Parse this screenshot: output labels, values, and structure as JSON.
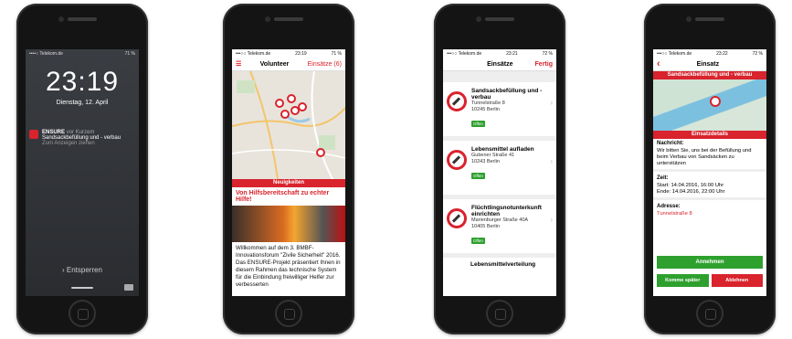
{
  "phone1": {
    "status_carrier": "••••○ Telekom.de",
    "status_battery": "71 %",
    "time": "23:19",
    "date": "Dienstag, 12. April",
    "notification_app": "ENSURE",
    "notification_time": "vor Kurzem",
    "notification_text": "Sandsackbefüllung und - verbau",
    "notification_hint": "Zum Anzeigen ziehen",
    "unlock_text": "› Entsperren"
  },
  "phone2": {
    "status_carrier": "•••○○ Telekom.de",
    "status_time": "23:19",
    "status_battery": "71 %",
    "nav_title": "Volunteer",
    "nav_right": "Einsätze (6)",
    "news_bar": "Neuigkeiten",
    "headline": "Von Hilfsbereitschaft zu echter Hilfe!",
    "article": "Willkommen auf dem 3. BMBF-Innovationsforum \"Zivile Sicherheit\" 2016. Das ENSURE-Projekt präsentiert Ihnen in diesem Rahmen das technische System für die Einbindung freiwilliger Helfer zur verbesserten"
  },
  "phone3": {
    "status_carrier": "•••○○ Telekom.de",
    "status_time": "23:21",
    "status_battery": "72 %",
    "nav_title": "Einsätze",
    "nav_right": "Fertig",
    "items": [
      {
        "title": "Sandsackbefüllung und - verbau",
        "street": "Tunnelstraße 8",
        "city": "10245 Berlin",
        "badge": "Offen"
      },
      {
        "title": "Lebensmittel aufladen",
        "street": "Gubener Straße 41",
        "city": "10243 Berlin",
        "badge": "Offen"
      },
      {
        "title": "Flüchtlingsnotunterkunft einrichten",
        "street": "Marienburger Straße 40A",
        "city": "10405 Berlin",
        "badge": "Offen"
      }
    ],
    "partial_item": "Lebensmittelverteilung"
  },
  "phone4": {
    "status_carrier": "•••○○ Telekom.de",
    "status_time": "23:22",
    "status_battery": "72 %",
    "nav_back": "‹",
    "nav_title": "Einsatz",
    "title_bar": "Sandsackbefüllung und - verbau",
    "details_bar": "Einsatzdetails",
    "label_message": "Nachricht:",
    "message": "Wir bitten Sie, uns bei der Befüllung und beim Verbau von Sandsäcken zu unterstützen",
    "label_time": "Zeit:",
    "start": "Start: 14.04.2016, 16:00 Uhr",
    "end": "Ende: 14.04.2016, 22:00 Uhr",
    "label_address": "Adresse:",
    "address": "Tunnelstraße 8",
    "btn_accept": "Annehmen",
    "btn_later": "Komme später",
    "btn_decline": "Ablehnen"
  }
}
